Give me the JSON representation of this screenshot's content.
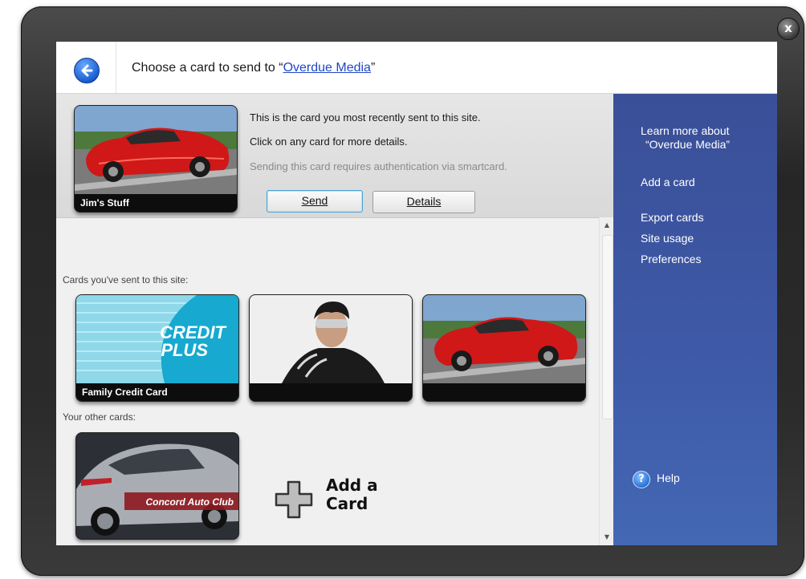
{
  "window": {
    "close_glyph": "x"
  },
  "header": {
    "title_prefix": "Choose a card to send to “",
    "site_name": "Overdue Media",
    "title_suffix": "”"
  },
  "recent_card": {
    "label": "Jim's Stuff",
    "info_recent": "This is the card you most recently sent to this site.",
    "info_click": "Click on any card for more details.",
    "info_auth": "Sending this card requires authentication via smartcard.",
    "send_label": "Send",
    "details_label": "Details"
  },
  "sent_cards": {
    "section_label": "Cards you've sent to this site:",
    "cards": [
      {
        "label": "Family Credit Card",
        "brand_line1": "CREDIT",
        "brand_line2": "PLUS"
      },
      {
        "label": ""
      },
      {
        "label": ""
      }
    ]
  },
  "other_cards": {
    "section_label": "Your other cards:",
    "cards": [
      {
        "label": "Concord Auto Club"
      }
    ],
    "add_card_label_line1": "Add a",
    "add_card_label_line2": "Card"
  },
  "sidebar": {
    "learn_more_line1": "Learn more about",
    "learn_more_line2": "“Overdue Media”",
    "add_card": "Add a card",
    "export_cards": "Export cards",
    "site_usage": "Site usage",
    "preferences": "Preferences",
    "help": "Help",
    "help_glyph": "?"
  },
  "colors": {
    "link": "#1f47c8",
    "sidebar_bg": "#3e5aa8",
    "frame": "#2b2b2b"
  }
}
